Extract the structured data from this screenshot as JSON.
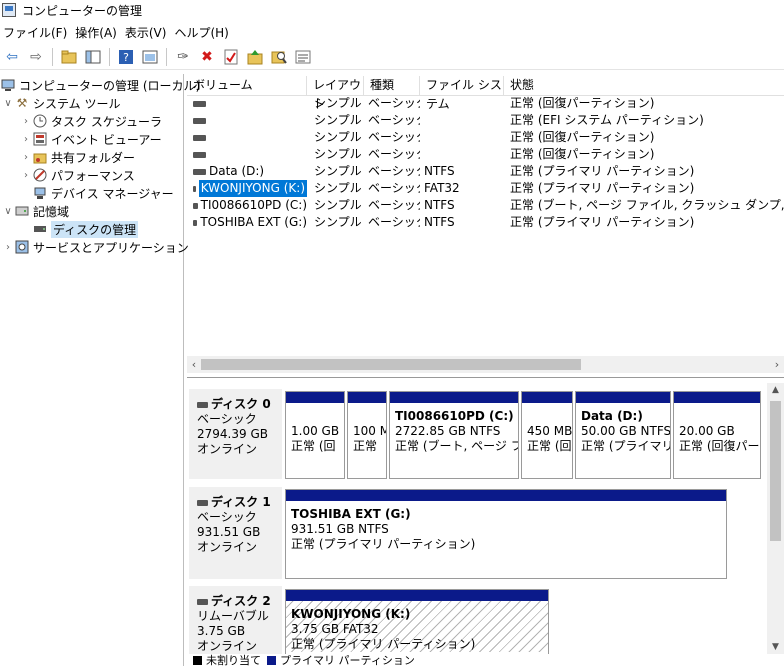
{
  "window": {
    "title": "コンピューターの管理"
  },
  "menu": [
    "ファイル(F)",
    "操作(A)",
    "表示(V)",
    "ヘルプ(H)"
  ],
  "toolbar_icons": [
    "back-arrow-icon",
    "forward-arrow-icon",
    "folder-up-icon",
    "console-tree-icon",
    "help-icon",
    "view-icon",
    "connect-icon",
    "delete-icon",
    "properties-icon",
    "import-icon",
    "search-icon",
    "list-icon"
  ],
  "tree": {
    "root": "コンピューターの管理 (ローカル)",
    "system_tools": "システム ツール",
    "task_scheduler": "タスク スケジューラ",
    "event_viewer": "イベント ビューアー",
    "shared_folders": "共有フォルダー",
    "performance": "パフォーマンス",
    "device_manager": "デバイス マネージャー",
    "storage": "記憶域",
    "disk_management": "ディスクの管理",
    "services_apps": "サービスとアプリケーション"
  },
  "volume_columns": [
    "ボリューム",
    "レイアウト",
    "種類",
    "ファイル システム",
    "状態"
  ],
  "volumes": [
    {
      "name": "",
      "layout": "シンプル",
      "type": "ベーシック",
      "fs": "",
      "status": "正常 (回復パーティション)"
    },
    {
      "name": "",
      "layout": "シンプル",
      "type": "ベーシック",
      "fs": "",
      "status": "正常 (EFI システム パーティション)"
    },
    {
      "name": "",
      "layout": "シンプル",
      "type": "ベーシック",
      "fs": "",
      "status": "正常 (回復パーティション)"
    },
    {
      "name": "",
      "layout": "シンプル",
      "type": "ベーシック",
      "fs": "",
      "status": "正常 (回復パーティション)"
    },
    {
      "name": "Data (D:)",
      "layout": "シンプル",
      "type": "ベーシック",
      "fs": "NTFS",
      "status": "正常 (プライマリ パーティション)"
    },
    {
      "name": "KWONJIYONG (K:)",
      "layout": "シンプル",
      "type": "ベーシック",
      "fs": "FAT32",
      "status": "正常 (プライマリ パーティション)"
    },
    {
      "name": "TI0086610PD (C:)",
      "layout": "シンプル",
      "type": "ベーシック",
      "fs": "NTFS",
      "status": "正常 (ブート, ページ ファイル, クラッシュ ダンプ, プライマリ パー"
    },
    {
      "name": "TOSHIBA EXT (G:)",
      "layout": "シンプル",
      "type": "ベーシック",
      "fs": "NTFS",
      "status": "正常 (プライマリ パーティション)"
    }
  ],
  "disks": [
    {
      "name": "ディスク 0",
      "kind": "ベーシック",
      "size": "2794.39 GB",
      "state": "オンライン",
      "parts": [
        {
          "label": "",
          "size": "1.00 GB",
          "status": "正常 (回"
        },
        {
          "label": "",
          "size": "100 M",
          "status": "正常"
        },
        {
          "label": "TI0086610PD  (C:)",
          "size": "2722.85 GB NTFS",
          "status": "正常 (ブート, ページ ファイ."
        },
        {
          "label": "",
          "size": "450 MB",
          "status": "正常 (回"
        },
        {
          "label": "Data  (D:)",
          "size": "50.00 GB NTFS",
          "status": "正常 (プライマリ /"
        },
        {
          "label": "",
          "size": "20.00 GB",
          "status": "正常 (回復パー"
        }
      ]
    },
    {
      "name": "ディスク 1",
      "kind": "ベーシック",
      "size": "931.51 GB",
      "state": "オンライン",
      "parts": [
        {
          "label": "TOSHIBA EXT  (G:)",
          "size": "931.51 GB NTFS",
          "status": "正常 (プライマリ パーティション)"
        }
      ]
    },
    {
      "name": "ディスク 2",
      "kind": "リムーバブル",
      "size": "3.75 GB",
      "state": "オンライン",
      "parts": [
        {
          "label": "KWONJIYONG  (K:)",
          "size": "3.75 GB FAT32",
          "status": "正常 (プライマリ パーティション)"
        }
      ]
    }
  ],
  "legend": [
    {
      "label": "未割り当て",
      "color": "#000000"
    },
    {
      "label": "プライマリ パーティション",
      "color": "#0b1a8a"
    }
  ]
}
